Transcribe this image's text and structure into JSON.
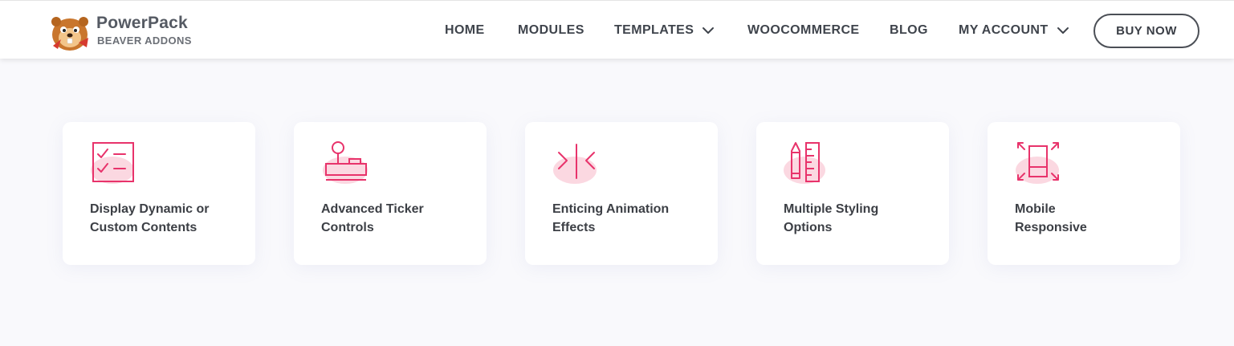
{
  "header": {
    "logo_title": "PowerPack",
    "logo_subtitle": "BEAVER ADDONS",
    "nav": [
      {
        "label": "HOME"
      },
      {
        "label": "MODULES"
      },
      {
        "label": "TEMPLATES"
      },
      {
        "label": "WOOCOMMERCE"
      },
      {
        "label": "BLOG"
      },
      {
        "label": "MY ACCOUNT"
      }
    ],
    "buy_label": "BUY NOW"
  },
  "features": [
    {
      "icon": "checklist-icon",
      "line1": "Display Dynamic or",
      "line2": "Custom Contents"
    },
    {
      "icon": "joystick-icon",
      "line1": "Advanced Ticker",
      "line2": "Controls"
    },
    {
      "icon": "animation-arrows-icon",
      "line1": "Enticing Animation",
      "line2": "Effects"
    },
    {
      "icon": "pencil-ruler-icon",
      "line1": "Multiple Styling",
      "line2": "Options"
    },
    {
      "icon": "mobile-expand-icon",
      "line1": "Mobile",
      "line2": "Responsive"
    }
  ],
  "colors": {
    "accent": "#e8336b",
    "accent_blob": "#fad1dc",
    "text": "#3c3f45",
    "background": "#f9f9fc"
  }
}
